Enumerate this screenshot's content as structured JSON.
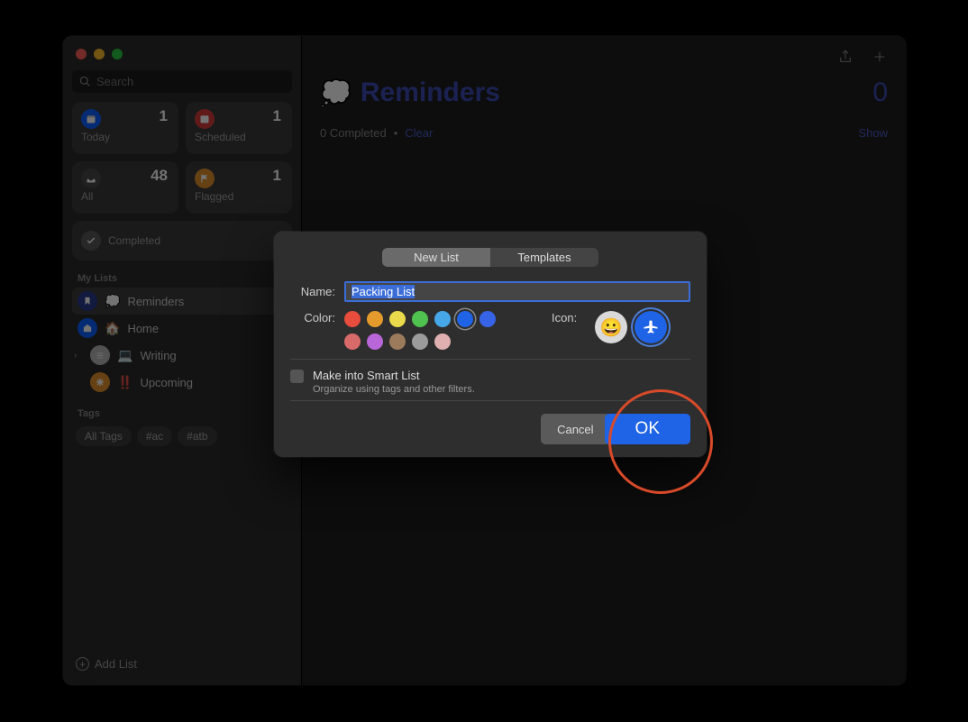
{
  "sidebar": {
    "search_placeholder": "Search",
    "cards": {
      "today": {
        "label": "Today",
        "count": "1",
        "color": "#0a60ff"
      },
      "scheduled": {
        "label": "Scheduled",
        "count": "1",
        "color": "#d83b3b"
      },
      "all": {
        "label": "All",
        "count": "48",
        "color": "#4a4a4a"
      },
      "flagged": {
        "label": "Flagged",
        "count": "1",
        "color": "#e2902b"
      },
      "completed": {
        "label": "Completed",
        "color": "#5a5a5a"
      }
    },
    "section_my_lists": "My Lists",
    "lists": [
      {
        "name": "Reminders",
        "badge_color": "#2a3a8f",
        "emoji": "💭"
      },
      {
        "name": "Home",
        "badge_color": "#0a60ff",
        "emoji": "🏠"
      },
      {
        "name": "Writing",
        "badge_color": "#b5b5b5",
        "emoji": "💻",
        "disclosure": true
      },
      {
        "name": "Upcoming",
        "badge_color": "#e2902b",
        "emoji": "‼️"
      }
    ],
    "section_tags": "Tags",
    "tags": [
      "All Tags",
      "#ac",
      "#atb"
    ],
    "add_list_label": "Add List"
  },
  "main": {
    "title": "Reminders",
    "title_emoji": "💭",
    "count": "0",
    "completed_text": "0 Completed",
    "clear_text": "Clear",
    "show_text": "Show"
  },
  "dialog": {
    "tab_new": "New List",
    "tab_templates": "Templates",
    "name_label": "Name:",
    "name_value": "Packing List",
    "color_label": "Color:",
    "colors": [
      "#e74c3c",
      "#e59b2b",
      "#ead94a",
      "#4fc24f",
      "#46a8e8",
      "#1f63e6",
      "#3764e6",
      "#d86a6a",
      "#b966d8",
      "#9c7a5c",
      "#9c9c9c",
      "#e0b0b0"
    ],
    "color_selected_index": 5,
    "icon_label": "Icon:",
    "smart_title": "Make into Smart List",
    "smart_sub": "Organize using tags and other filters.",
    "cancel": "Cancel",
    "ok": "OK"
  }
}
